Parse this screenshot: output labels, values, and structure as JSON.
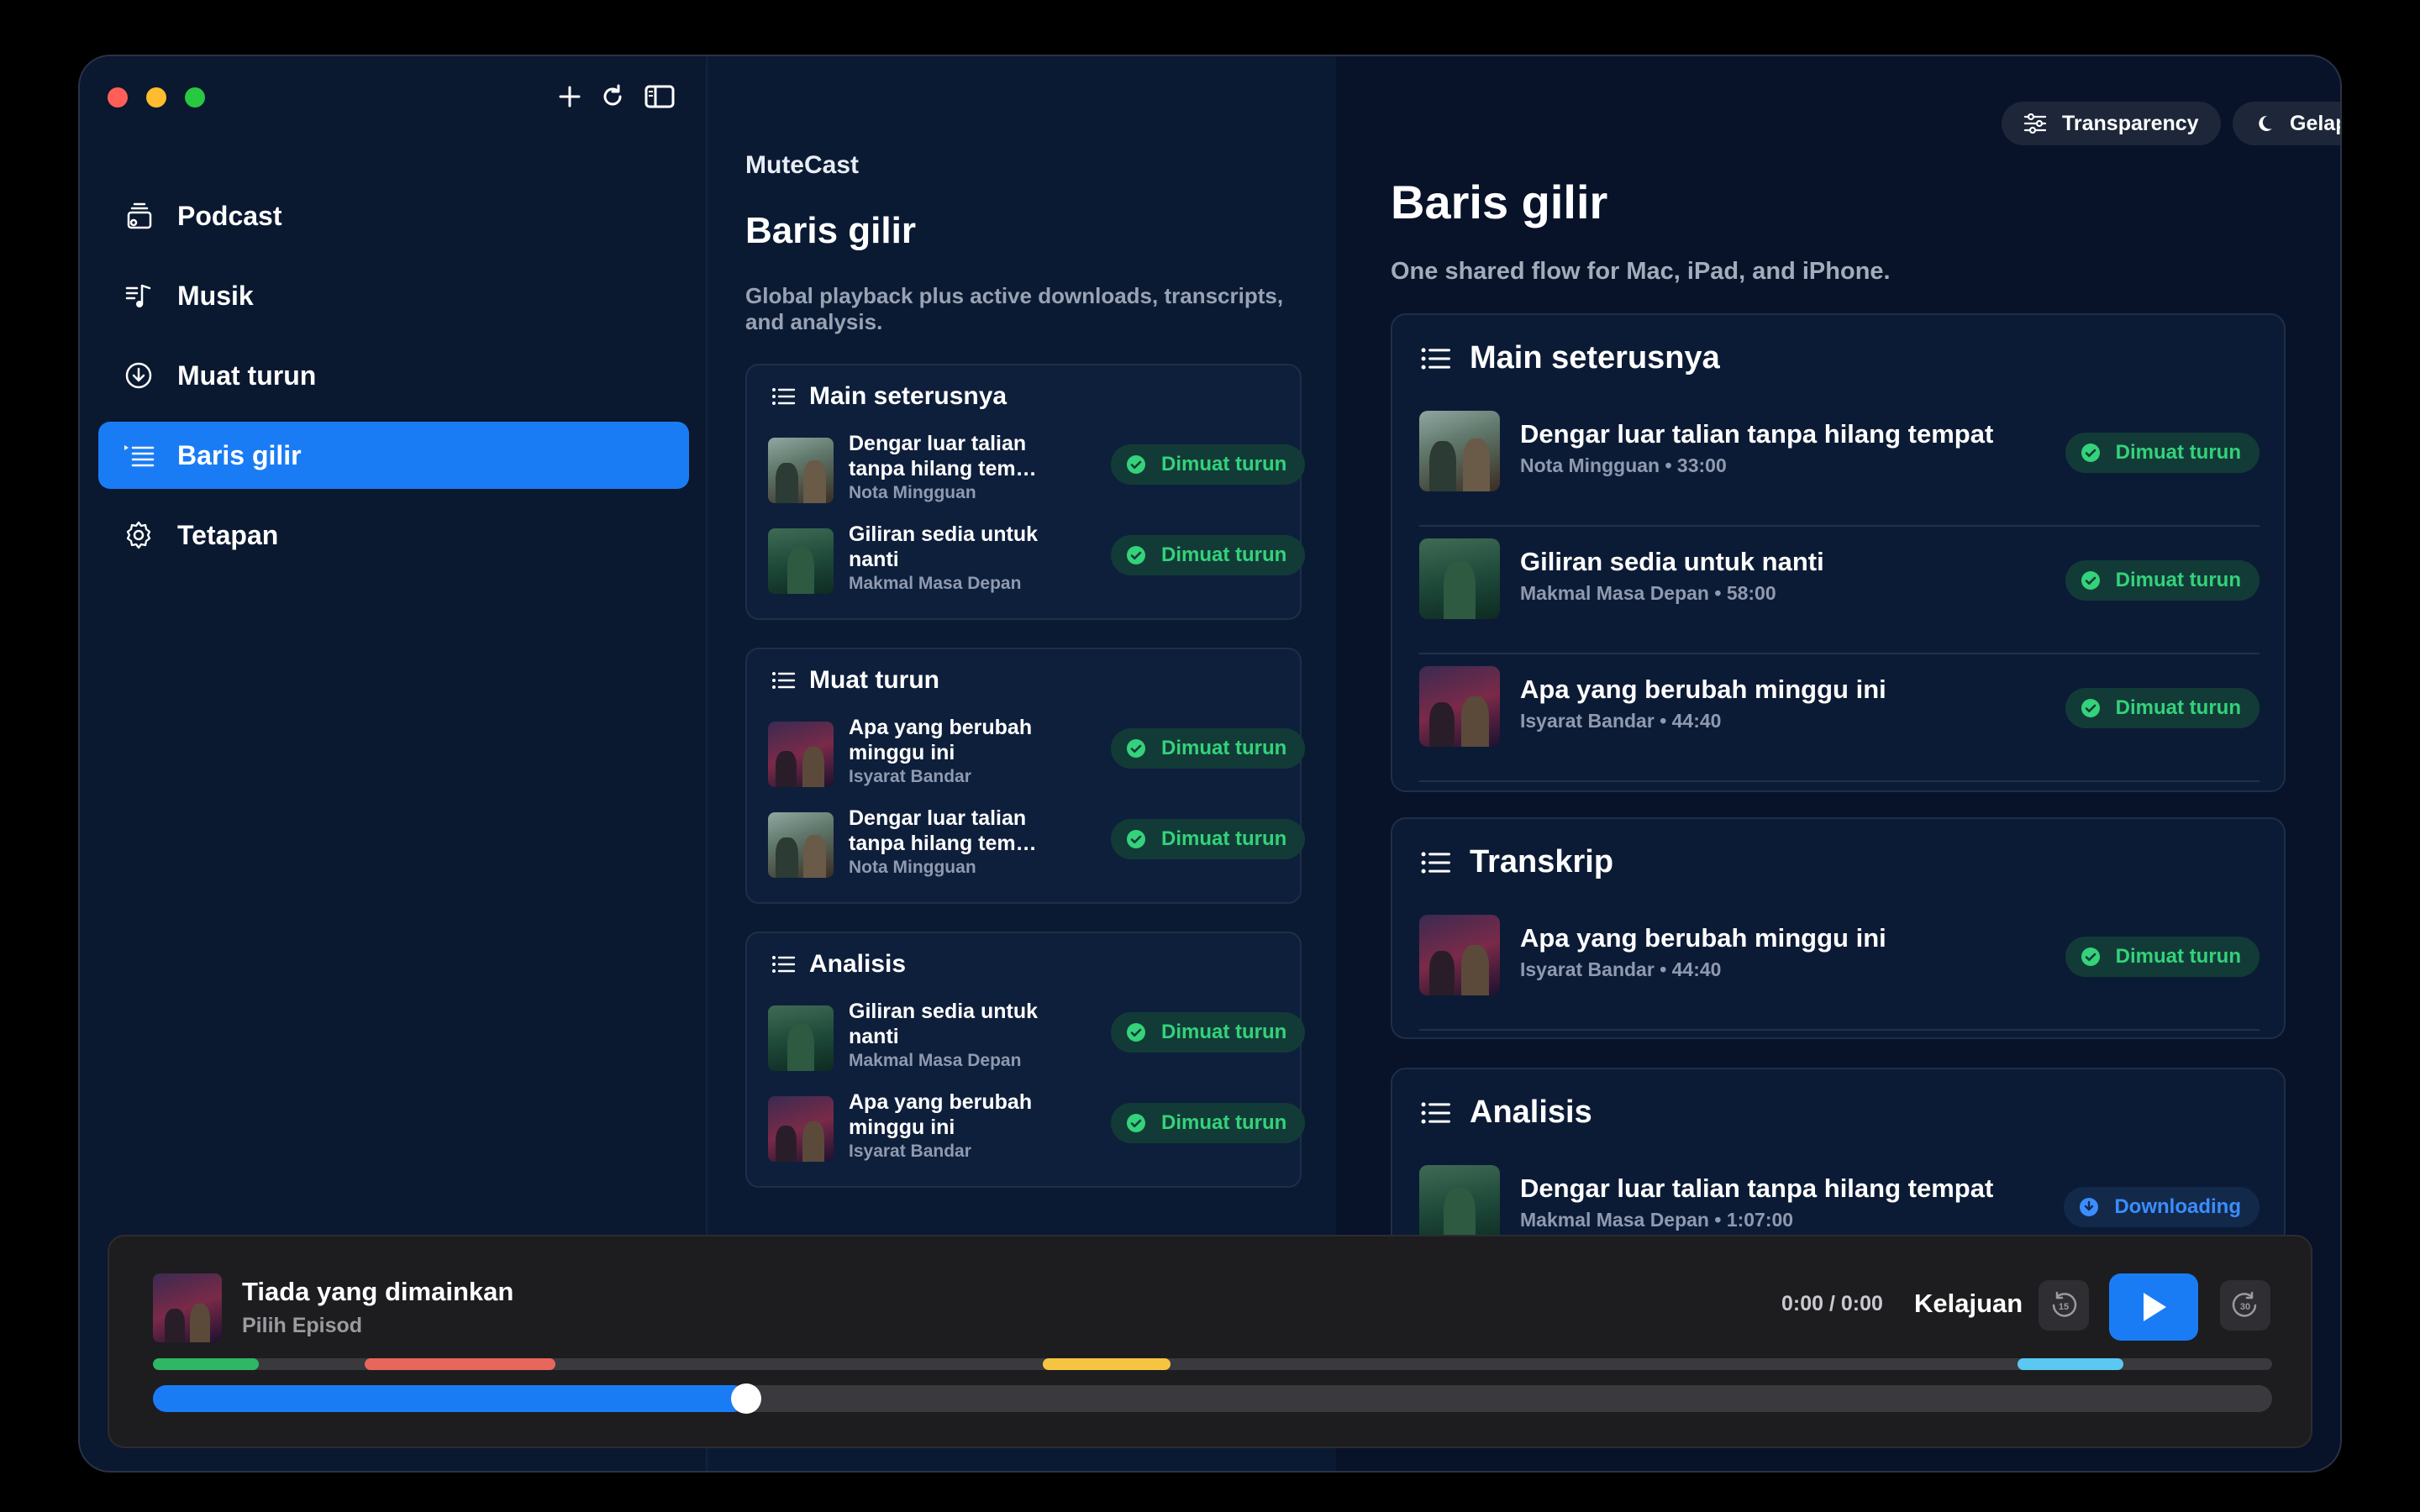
{
  "window": {
    "toolbar": {
      "add_icon": "plus-icon",
      "refresh_icon": "refresh-icon",
      "sidebar_icon": "sidebar-toggle-icon"
    }
  },
  "sidebar": {
    "items": [
      {
        "label": "Podcast",
        "icon": "podcast-icon",
        "active": false
      },
      {
        "label": "Musik",
        "icon": "music-icon",
        "active": false
      },
      {
        "label": "Muat turun",
        "icon": "download-icon",
        "active": false
      },
      {
        "label": "Baris gilir",
        "icon": "queue-list-icon",
        "active": true
      },
      {
        "label": "Tetapan",
        "icon": "gear-icon",
        "active": false
      }
    ]
  },
  "middle": {
    "app_name": "MuteCast",
    "title": "Baris gilir",
    "subtitle": "Global playback plus active downloads, transcripts, and analysis.",
    "sections": [
      {
        "title": "Main seterusnya",
        "rows": [
          {
            "title": "Dengar luar talian tanpa hilang tem…",
            "meta": "Nota Mingguan",
            "status": "Dimuat turun",
            "art": "a"
          },
          {
            "title": "Giliran sedia untuk nanti",
            "meta": "Makmal Masa Depan",
            "status": "Dimuat turun",
            "art": "b"
          }
        ]
      },
      {
        "title": "Muat turun",
        "rows": [
          {
            "title": "Apa yang berubah minggu ini",
            "meta": "Isyarat Bandar",
            "status": "Dimuat turun",
            "art": "c"
          },
          {
            "title": "Dengar luar talian tanpa hilang tem…",
            "meta": "Nota Mingguan",
            "status": "Dimuat turun",
            "art": "a"
          }
        ]
      },
      {
        "title": "Analisis",
        "rows": [
          {
            "title": "Giliran sedia untuk nanti",
            "meta": "Makmal Masa Depan",
            "status": "Dimuat turun",
            "art": "b"
          },
          {
            "title": "Apa yang berubah minggu ini",
            "meta": "Isyarat Bandar",
            "status": "Dimuat turun",
            "art": "c"
          }
        ]
      }
    ]
  },
  "right": {
    "transparency_label": "Transparency",
    "theme_label": "Gelap",
    "title": "Baris gilir",
    "subtitle": "One shared flow for Mac, iPad, and iPhone.",
    "sections": [
      {
        "title": "Main seterusnya",
        "rows": [
          {
            "title": "Dengar luar talian tanpa hilang tempat",
            "meta": "Nota Mingguan • 33:00",
            "status": "Dimuat turun",
            "art": "a"
          },
          {
            "title": "Giliran sedia untuk nanti",
            "meta": "Makmal Masa Depan • 58:00",
            "status": "Dimuat turun",
            "art": "b"
          },
          {
            "title": "Apa yang berubah minggu ini",
            "meta": "Isyarat Bandar • 44:40",
            "status": "Dimuat turun",
            "art": "c"
          }
        ]
      },
      {
        "title": "Transkrip",
        "rows": [
          {
            "title": "Apa yang berubah minggu ini",
            "meta": "Isyarat Bandar • 44:40",
            "status": "Dimuat turun",
            "art": "c"
          }
        ]
      },
      {
        "title": "Analisis",
        "rows": [
          {
            "title": "Dengar luar talian tanpa hilang tempat",
            "meta": "Makmal Masa Depan • 1:07:00",
            "status": "Downloading",
            "art": "b"
          }
        ]
      }
    ]
  },
  "player": {
    "title": "Tiada yang dimainkan",
    "subtitle": "Pilih Episod",
    "time": "0:00 / 0:00",
    "speed_label": "Kelajuan",
    "skip_back_label": "15",
    "skip_forward_label": "30",
    "progress_fraction": 0.28,
    "chapters": [
      {
        "start": 0.0,
        "end": 0.05,
        "color": "#2fb765"
      },
      {
        "start": 0.1,
        "end": 0.19,
        "color": "#e8675c"
      },
      {
        "start": 0.42,
        "end": 0.48,
        "color": "#f5c542"
      },
      {
        "start": 0.88,
        "end": 0.93,
        "color": "#5ac8f0"
      }
    ]
  },
  "colors": {
    "accent": "#1a7cf5",
    "success": "#34d27a",
    "success_bg": "#123b38"
  }
}
